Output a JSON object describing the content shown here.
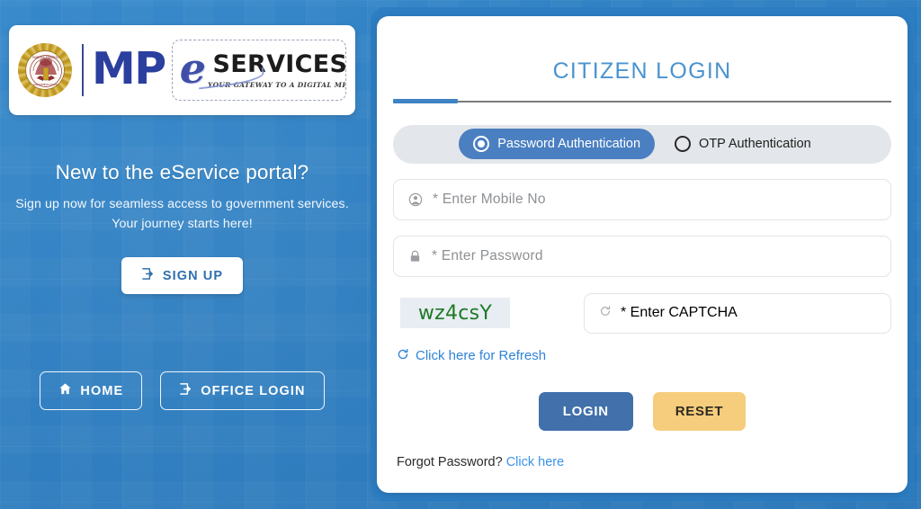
{
  "brand": {
    "emblem_name": "mp-government-emblem",
    "mp_text": "MP",
    "e_glyph": "e",
    "services_text": "SERVICES",
    "tagline": "YOUR GATEWAY TO A DIGITAL MP"
  },
  "left": {
    "headline": "New to the eService portal?",
    "subtext": "Sign up now for seamless access to government services. Your journey starts here!",
    "signup_label": "SIGN UP",
    "home_label": "HOME",
    "office_login_label": "OFFICE LOGIN"
  },
  "login": {
    "title": "CITIZEN LOGIN",
    "auth_options": [
      {
        "label": "Password Authentication",
        "selected": true
      },
      {
        "label": "OTP Authentication",
        "selected": false
      }
    ],
    "mobile_placeholder": "* Enter Mobile No",
    "mobile_value": "",
    "password_placeholder": "* Enter Password",
    "password_value": "",
    "captcha_text": "wz4csY",
    "captcha_placeholder": "* Enter CAPTCHA",
    "captcha_value": "",
    "refresh_label": "Click here for Refresh",
    "login_label": "LOGIN",
    "reset_label": "RESET",
    "forgot_prefix": "Forgot Password?",
    "forgot_link": "Click here"
  },
  "colors": {
    "page_blue": "#2c7fc4",
    "title_blue": "#4a93cf",
    "accent_blue": "#3f83c4",
    "selected_pill": "#4a7fc1",
    "toggle_track": "#e3e6ea",
    "login_button": "#4170ab",
    "reset_button": "#f6cd7c",
    "captcha_green": "#1e7a24",
    "captcha_bg": "#e8edf3",
    "link_blue": "#2f83d6",
    "mp_navy": "#2b3f9e"
  }
}
